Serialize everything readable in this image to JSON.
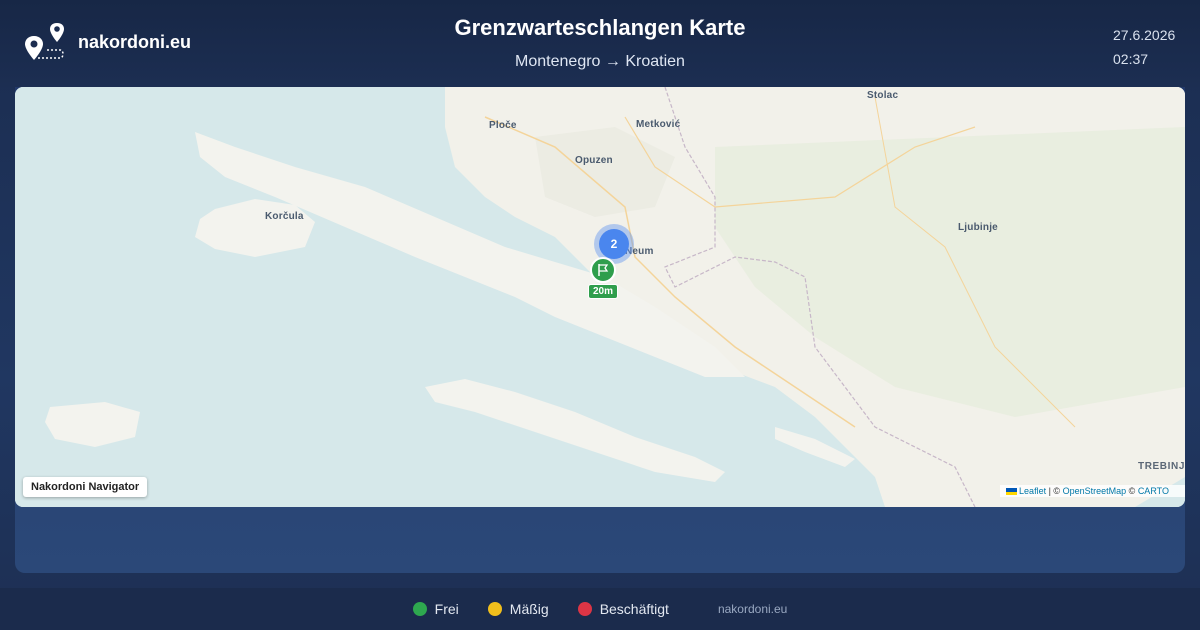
{
  "brand": {
    "name": "nakordoni.eu",
    "logo_icon": "map-pins-icon"
  },
  "header": {
    "title": "Grenzwarteschlangen Karte",
    "route_from": "Montenegro",
    "route_arrow": "→",
    "route_to": "Kroatien",
    "date": "27.6.2026",
    "time": "02:37"
  },
  "map": {
    "places": {
      "stolac": "Stolac",
      "ploce": "Ploče",
      "metkovic": "Metković",
      "opuzen": "Opuzen",
      "korcula": "Korčula",
      "neum": "Neum",
      "ljubinje": "Ljubinje",
      "trebinje": "TREBINJ"
    },
    "cluster_count": "2",
    "wait_badge": "20m",
    "nav_label": "Nakordoni Navigator",
    "attribution": {
      "leaflet": "Leaflet",
      "sep1": "| ©",
      "osm": "OpenStreetMap",
      "sep2": "©",
      "carto": "CARTO"
    },
    "colors": {
      "water": "#d6e8ea",
      "land": "#f2f1ea",
      "cluster": "#4a86ee",
      "marker": "#2f9e4c"
    }
  },
  "legend": {
    "items": [
      {
        "label": "Frei",
        "color": "#2ea84f"
      },
      {
        "label": "Mäßig",
        "color": "#f1bf1c"
      },
      {
        "label": "Beschäftigt",
        "color": "#dc3545"
      }
    ],
    "site": "nakordoni.eu"
  }
}
